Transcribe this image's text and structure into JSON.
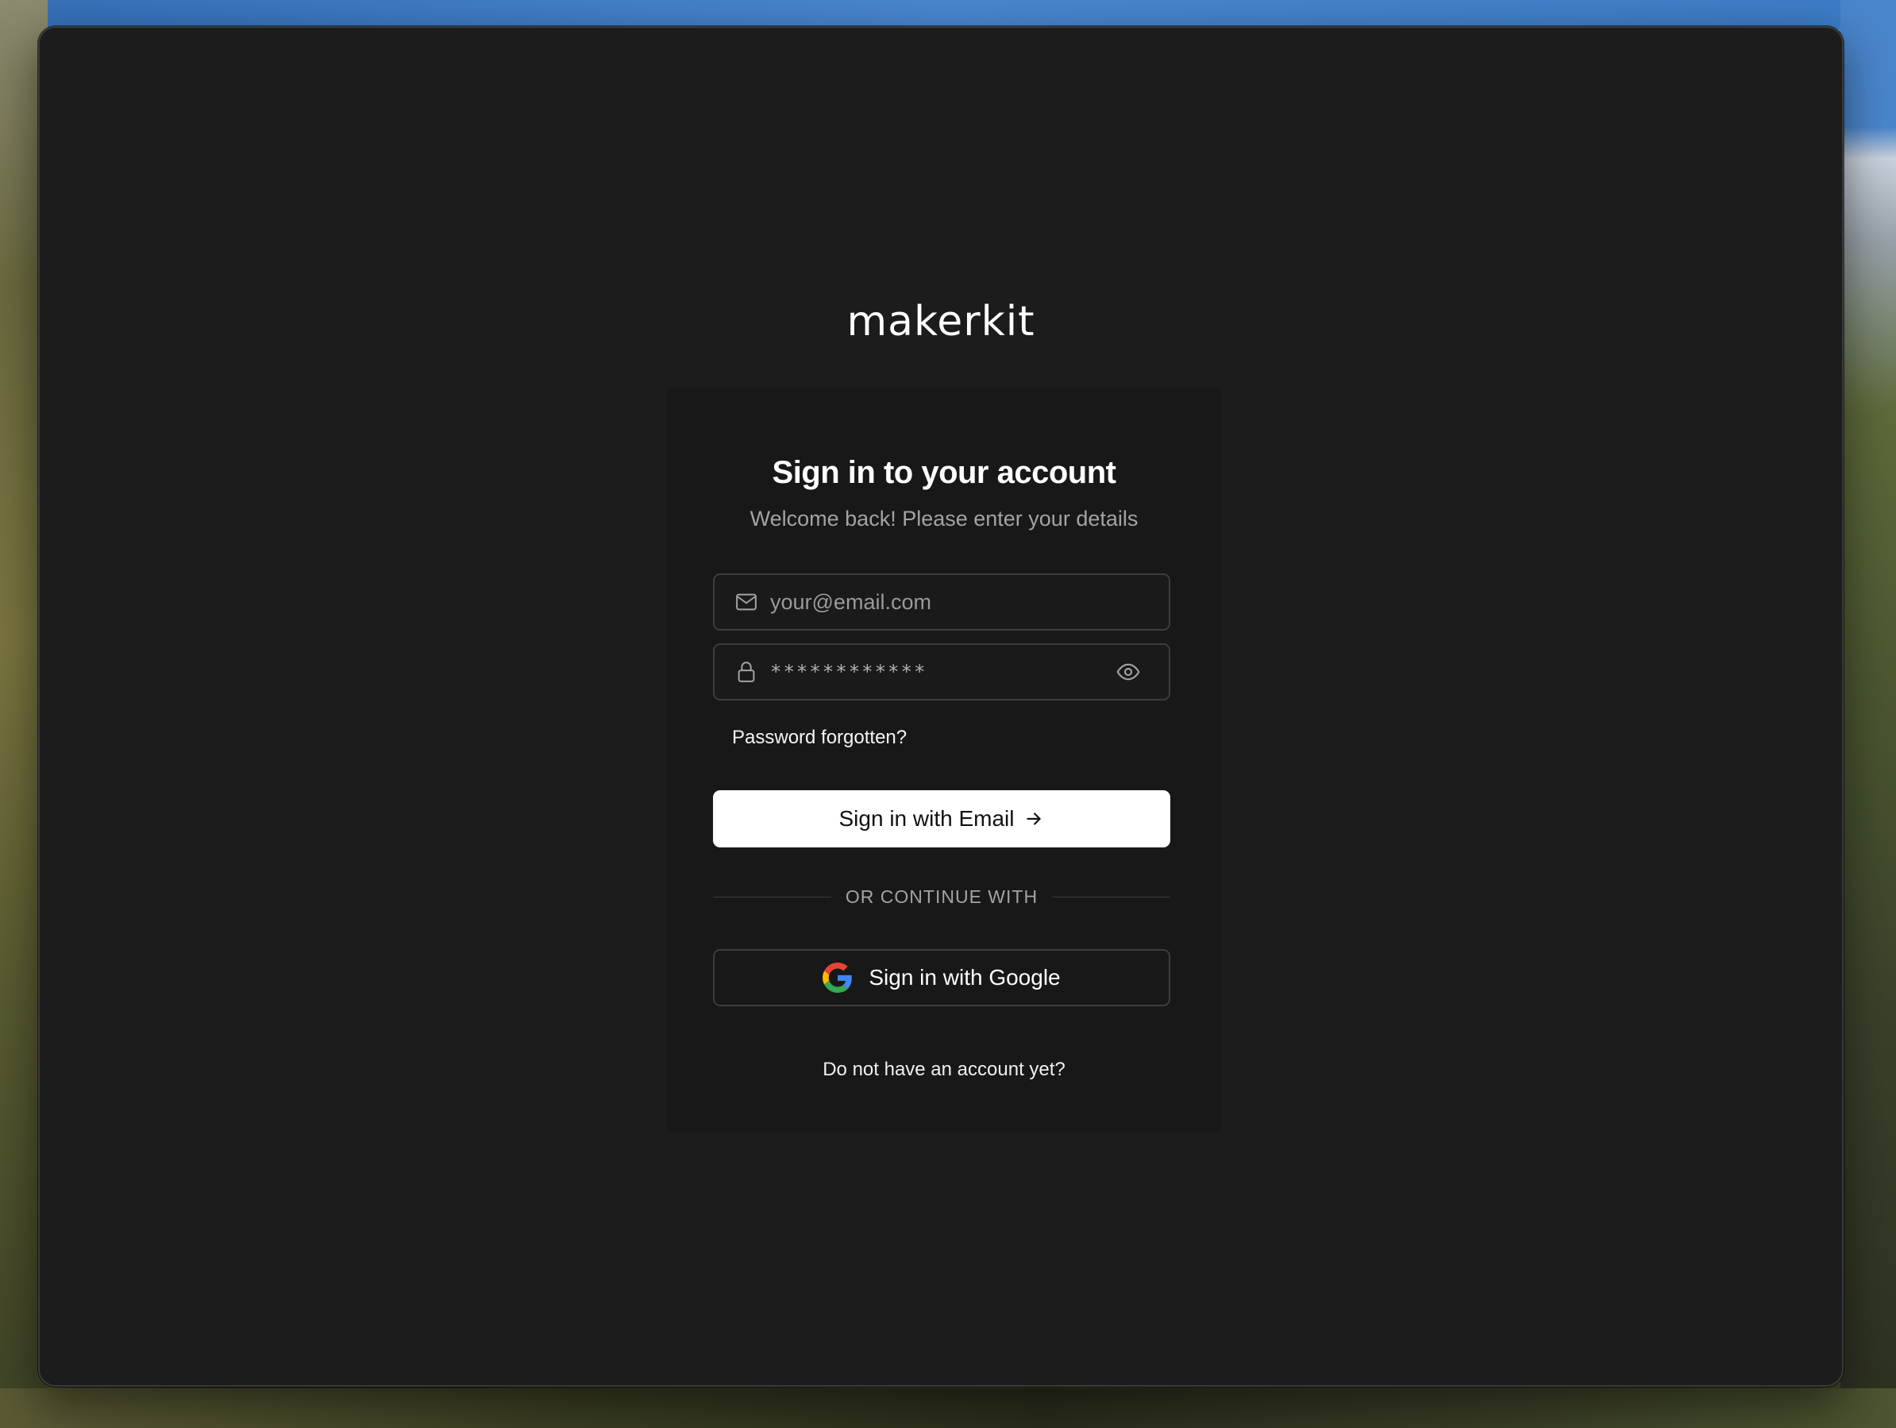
{
  "brand": {
    "logo_text": "makerkit"
  },
  "signin": {
    "title": "Sign in to your account",
    "subtitle": "Welcome back! Please enter your details",
    "email_placeholder": "your@email.com",
    "email_value": "",
    "password_masked": "************",
    "forgot_label": "Password forgotten?",
    "email_button_label": "Sign in with Email",
    "divider_label": "OR CONTINUE WITH",
    "google_button_label": "Sign in with Google",
    "signup_link": "Do not have an account yet?"
  },
  "icons": {
    "email": "mail-icon",
    "password": "lock-icon",
    "toggle_visibility": "eye-icon",
    "email_button": "arrow-right-icon",
    "google": "google-icon"
  },
  "colors": {
    "window_bg": "#1c1c1c",
    "card_bg": "#181818",
    "primary_button_bg": "#ffffff",
    "primary_button_text": "#111111",
    "border": "#3d3d3d",
    "muted_text": "#a3a3a3"
  }
}
